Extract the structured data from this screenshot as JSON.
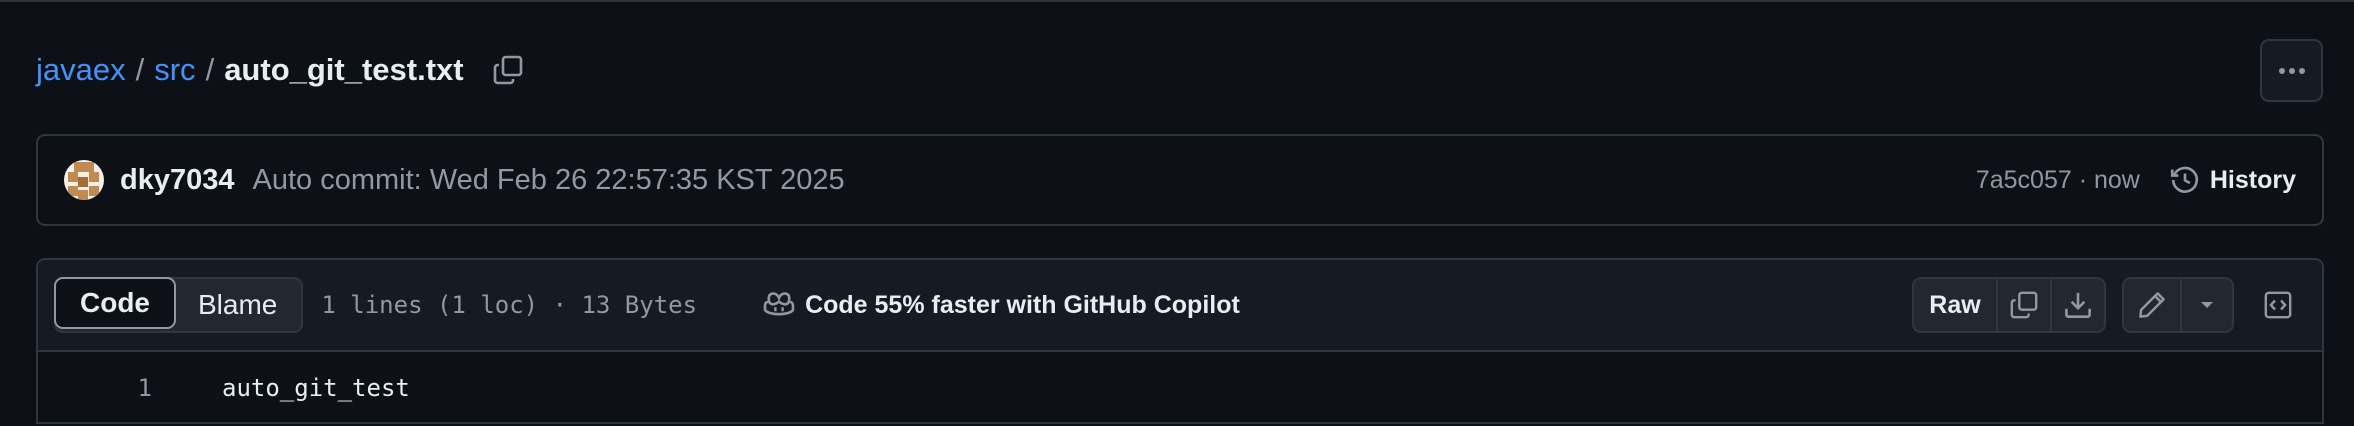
{
  "breadcrumb": {
    "repo": "javaex",
    "sep1": "/",
    "folder": "src",
    "sep2": "/",
    "file": "auto_git_test.txt",
    "copy_icon": "copy-icon"
  },
  "more_button_icon": "kebab-horizontal-icon",
  "commit": {
    "author": "dky7034",
    "message": "Auto commit: Wed Feb 26 22:57:35 KST 2025",
    "hash": "7a5c057",
    "time": "now",
    "meta": "7a5c057 · now",
    "history_label": "History",
    "history_icon": "history-icon"
  },
  "file_header": {
    "tabs": [
      {
        "label": "Code",
        "active": true
      },
      {
        "label": "Blame",
        "active": false
      }
    ],
    "info": "1 lines (1 loc) · 13 Bytes",
    "copilot_text": "Code 55% faster with GitHub Copilot",
    "copilot_icon": "copilot-icon",
    "raw_label": "Raw",
    "icons": [
      "copy-icon",
      "download-icon",
      "pencil-icon",
      "triangle-down-icon",
      "code-square-icon"
    ]
  },
  "code": {
    "lines": [
      {
        "number": "1",
        "text": "auto_git_test"
      }
    ]
  },
  "colors": {
    "background": "#0d1117",
    "border": "#30363d",
    "link": "#4493f8",
    "muted": "#9198a1",
    "text": "#e6edf3"
  }
}
